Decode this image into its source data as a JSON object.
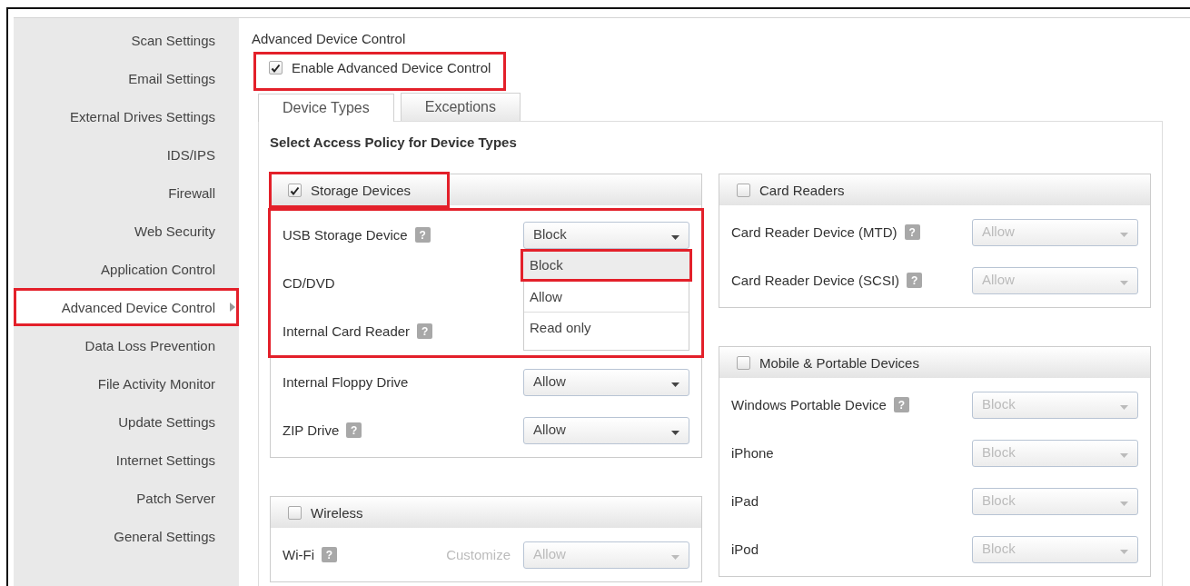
{
  "sidebar": {
    "items": [
      {
        "label": "Scan Settings",
        "selected": false
      },
      {
        "label": "Email Settings",
        "selected": false
      },
      {
        "label": "External Drives Settings",
        "selected": false
      },
      {
        "label": "IDS/IPS",
        "selected": false
      },
      {
        "label": "Firewall",
        "selected": false
      },
      {
        "label": "Web Security",
        "selected": false
      },
      {
        "label": "Application Control",
        "selected": false
      },
      {
        "label": "Advanced Device Control",
        "selected": true,
        "highlighted": true
      },
      {
        "label": "Data Loss Prevention",
        "selected": false
      },
      {
        "label": "File Activity Monitor",
        "selected": false
      },
      {
        "label": "Update Settings",
        "selected": false
      },
      {
        "label": "Internet Settings",
        "selected": false
      },
      {
        "label": "Patch Server",
        "selected": false
      },
      {
        "label": "General Settings",
        "selected": false
      }
    ]
  },
  "page_title": "Advanced Device Control",
  "enable": {
    "label": "Enable Advanced Device Control",
    "checked": true,
    "highlighted": true
  },
  "tabs": [
    {
      "label": "Device Types",
      "selected": true
    },
    {
      "label": "Exceptions",
      "selected": false
    }
  ],
  "section_heading": "Select Access Policy for Device Types",
  "columns": [
    {
      "groups": [
        {
          "title": "Storage Devices",
          "checked": true,
          "highlighted": true,
          "rows": [
            {
              "label": "USB Storage Device",
              "help": "?",
              "value": "Block",
              "highlighted": true,
              "options": [
                {
                  "label": "Block",
                  "selected": true,
                  "highlighted": true
                },
                {
                  "label": "Allow",
                  "selected": false
                },
                {
                  "label": "Read only",
                  "selected": false
                }
              ]
            },
            {
              "label": "CD/DVD",
              "highlighted": true
            },
            {
              "label": "Internal Card Reader",
              "help": "?",
              "highlighted": true
            },
            {
              "label": "Internal Floppy Drive",
              "value": "Allow"
            },
            {
              "label": "ZIP Drive",
              "help": "?",
              "value": "Allow"
            }
          ]
        },
        {
          "title": "Wireless",
          "checked": false,
          "rows": [
            {
              "label": "Wi-Fi",
              "help": "?",
              "link": "Customize",
              "value": "Allow"
            }
          ]
        }
      ]
    },
    {
      "groups": [
        {
          "title": "Card Readers",
          "checked": false,
          "rows": [
            {
              "label": "Card Reader Device (MTD)",
              "help": "?",
              "value": "Allow"
            },
            {
              "label": "Card Reader Device (SCSI)",
              "help": "?",
              "value": "Allow"
            }
          ]
        },
        {
          "title": "Mobile & Portable Devices",
          "checked": false,
          "rows": [
            {
              "label": "Windows Portable Device",
              "help": "?",
              "value": "Block"
            },
            {
              "label": "iPhone",
              "value": "Block"
            },
            {
              "label": "iPad",
              "value": "Block"
            },
            {
              "label": "iPod",
              "value": "Block"
            }
          ]
        }
      ]
    }
  ]
}
